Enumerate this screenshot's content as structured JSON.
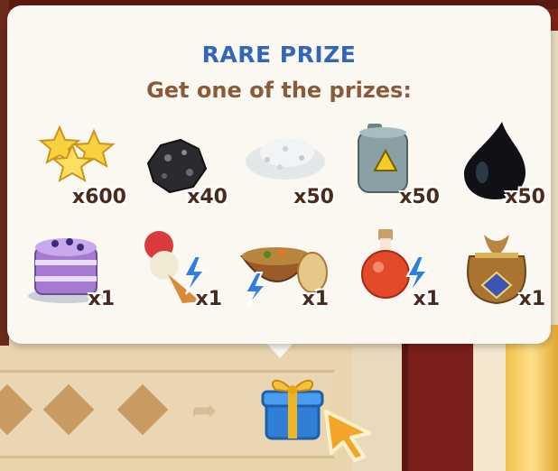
{
  "popup": {
    "title": "RARE PRIZE",
    "subtitle": "Get one of the prizes:"
  },
  "prizes": [
    {
      "item": "stars",
      "quantity": "x600"
    },
    {
      "item": "coal",
      "quantity": "x40"
    },
    {
      "item": "salt-pile",
      "quantity": "x50"
    },
    {
      "item": "fuel-canister",
      "quantity": "x50"
    },
    {
      "item": "oil-drop",
      "quantity": "x50"
    },
    {
      "item": "berry-cake",
      "quantity": "x1"
    },
    {
      "item": "ice-cream-boost",
      "quantity": "x1"
    },
    {
      "item": "stew-with-bread",
      "quantity": "x1"
    },
    {
      "item": "red-potion",
      "quantity": "x1"
    },
    {
      "item": "treasure-sack",
      "quantity": "x1"
    }
  ],
  "colors": {
    "title": "#3366bb",
    "subtitle": "#8b5a3a",
    "popup_bg": "#fbf8f2",
    "gift_box": "#3a8be0",
    "gift_ribbon": "#f0b323",
    "cursor": "#f0a020"
  }
}
